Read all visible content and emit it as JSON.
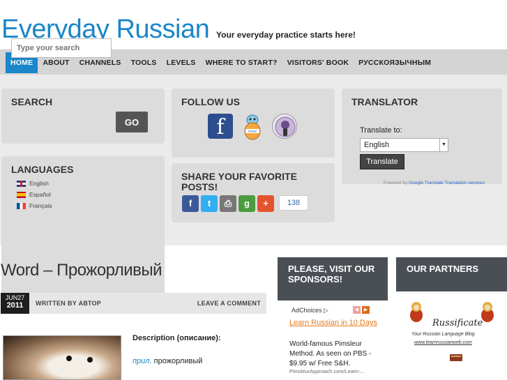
{
  "header": {
    "site_title": "Everyday Russian",
    "tagline": "Your everyday practice starts here!"
  },
  "nav": {
    "items": [
      "HOME",
      "ABOUT",
      "CHANNELS",
      "TOOLS",
      "LEVELS",
      "WHERE TO START?",
      "VISITORS' BOOK",
      "РУССКОЯЗЫЧНЫМ"
    ],
    "active_index": 0
  },
  "colors": {
    "accent": "#1b86c9",
    "nav_bg": "#d4d4d4",
    "widget_bg": "#dcdcdc",
    "sidebar_head": "#4a4e55"
  },
  "search": {
    "title": "SEARCH",
    "placeholder": "Type your search",
    "button_label": "GO"
  },
  "languages": {
    "title": "LANGUAGES",
    "items": [
      {
        "label": "English",
        "flag": "uk-flag-icon"
      },
      {
        "label": "Español",
        "flag": "spain-flag-icon"
      },
      {
        "label": "Français",
        "flag": "france-flag-icon"
      }
    ]
  },
  "follow": {
    "title": "FOLLOW US",
    "icons": [
      "facebook-icon",
      "mixx-icon",
      "podcast-icon"
    ]
  },
  "share": {
    "title": "SHARE YOUR FAVORITE POSTS!",
    "count": "138",
    "icons": [
      "facebook-share-icon",
      "twitter-share-icon",
      "print-share-icon",
      "google-share-icon",
      "more-share-icon"
    ]
  },
  "translator": {
    "title": "TRANSLATOR",
    "label": "Translate to:",
    "selected": "English",
    "button_label": "Translate",
    "powered_prefix": "Powered by",
    "google_translate": "Google Translate",
    "translation_services": "Translation services"
  },
  "post": {
    "title": "Word – Прожорливый",
    "date_month": "JUN27",
    "date_year": "2011",
    "written_by": "WRITTEN BY АВТОР",
    "leave_comment": "LEAVE A COMMENT",
    "desc_label": "Description (описание):",
    "desc_pos": "прил.",
    "desc_word": "прожорливый"
  },
  "sponsors": {
    "title": "PLEASE, VISIT OUR SPONSORS!",
    "adchoices": "AdChoices ▷",
    "ad_link": "Learn Russian in 10 Days",
    "ad_text": "World-famous Pimsleur Method. As seen on PBS - $9.95 w/ Free S&H.",
    "ad_url": "PimsleurApproach.com/Learn-..."
  },
  "partners": {
    "title": "OUR PARTNERS",
    "logo_title": "Russificate",
    "logo_sub": "Your Russian Language Blog",
    "logo_url": "www.learnrussianweb.com"
  }
}
